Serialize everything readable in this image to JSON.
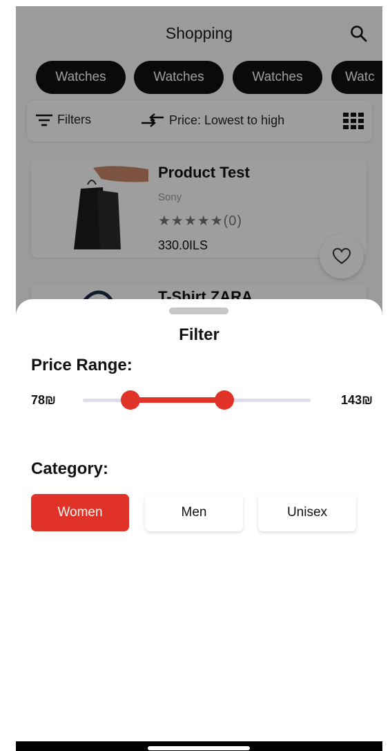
{
  "header": {
    "title": "Shopping"
  },
  "categories_chips": [
    "Watches",
    "Watches",
    "Watches",
    "Watc"
  ],
  "toolbar": {
    "filters_label": "Filters",
    "sort_label": "Price: Lowest to high"
  },
  "products": [
    {
      "name": "Product Test",
      "brand": "Sony",
      "rating": "★★★★★(0)",
      "price": "330.0ILS"
    },
    {
      "name": "T-Shirt ZARA"
    }
  ],
  "filter_sheet": {
    "title": "Filter",
    "price_range_label": "Price Range:",
    "min_label": "78₪",
    "max_label": "143₪",
    "slider_low_fraction": 0.21,
    "slider_high_fraction": 0.62,
    "category_label": "Category:",
    "category_options": [
      "Women",
      "Men",
      "Unisex"
    ],
    "selected_category": "Women"
  },
  "colors": {
    "accent": "#e03226",
    "chip_bg": "#111111",
    "track": "#dedbf0"
  }
}
